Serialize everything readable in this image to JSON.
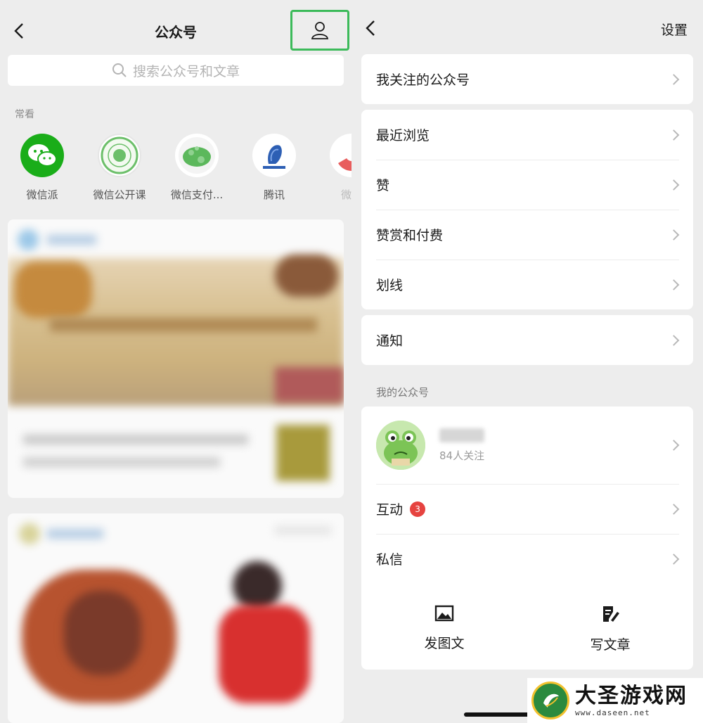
{
  "left": {
    "title": "公众号",
    "search_placeholder": "搜索公众号和文章",
    "section_label": "常看",
    "accounts": [
      {
        "name": "微信派"
      },
      {
        "name": "微信公开课"
      },
      {
        "name": "微信支付..."
      },
      {
        "name": "腾讯"
      },
      {
        "name": "微信"
      }
    ]
  },
  "right": {
    "settings_label": "设置",
    "followed_label": "我关注的公众号",
    "menu": [
      "最近浏览",
      "赞",
      "赞赏和付费",
      "划线"
    ],
    "notify_label": "通知",
    "section_label": "我的公众号",
    "followers": "84人关注",
    "interact_label": "互动",
    "interact_badge": "3",
    "message_label": "私信",
    "post_image_label": "发图文",
    "write_article_label": "写文章"
  },
  "watermark": {
    "title": "大圣游戏网",
    "url": "www.daseen.net"
  },
  "colors": {
    "accent_green": "#3cba5a",
    "badge_red": "#e64340",
    "background": "#ededed"
  }
}
